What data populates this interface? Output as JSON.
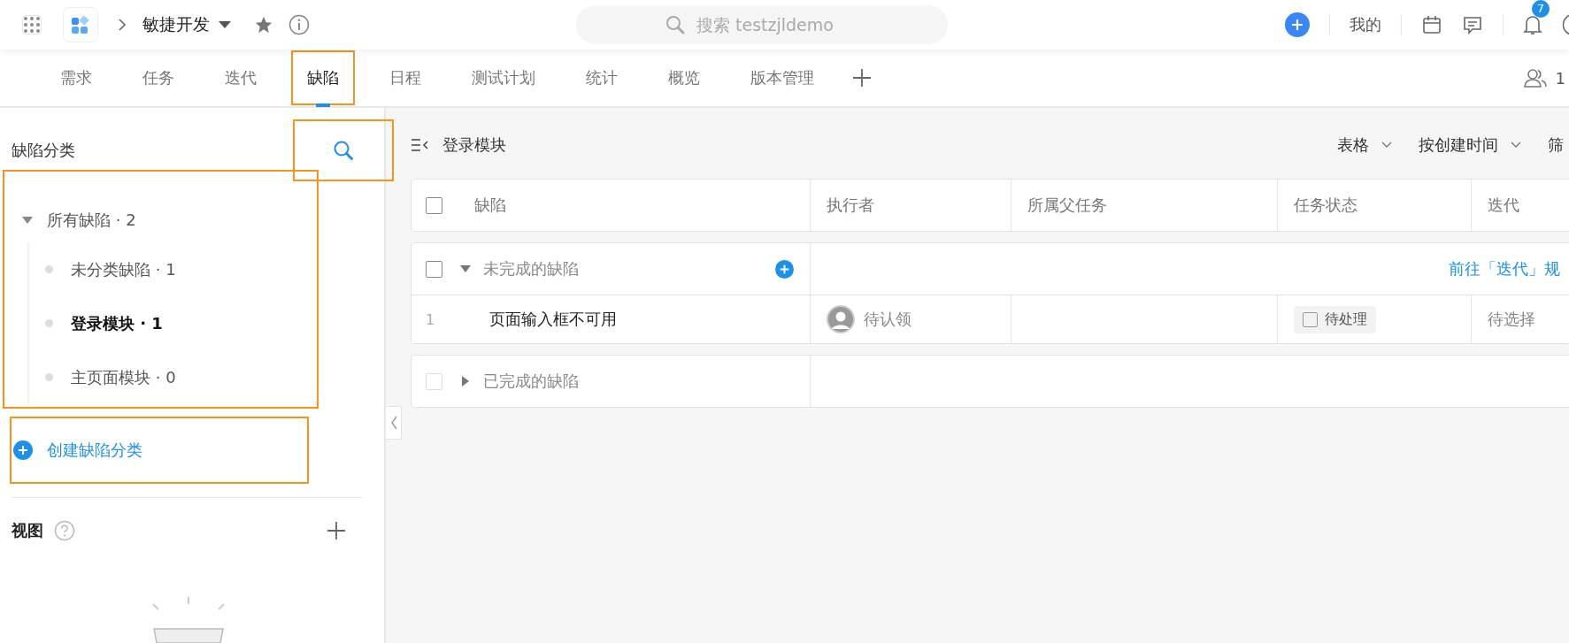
{
  "topbar": {
    "project": "敏捷开发",
    "search": {
      "placeholder": "搜索 testzjldemo"
    },
    "mine": "我的",
    "notifications": "7"
  },
  "tabs": [
    {
      "label": "需求",
      "selected": false,
      "highlighted": false
    },
    {
      "label": "任务",
      "selected": false,
      "highlighted": false
    },
    {
      "label": "迭代",
      "selected": false,
      "highlighted": false
    },
    {
      "label": "缺陷",
      "selected": true,
      "highlighted": true
    },
    {
      "label": "日程",
      "selected": false,
      "highlighted": false
    },
    {
      "label": "测试计划",
      "selected": false,
      "highlighted": false
    },
    {
      "label": "统计",
      "selected": false,
      "highlighted": false
    },
    {
      "label": "概览",
      "selected": false,
      "highlighted": false
    },
    {
      "label": "版本管理",
      "selected": false,
      "highlighted": false
    }
  ],
  "members": "1",
  "sidebar": {
    "title": "缺陷分类",
    "search_highlighted": true,
    "tree_highlighted": true,
    "tree": [
      {
        "label": "所有缺陷 · 2",
        "expanded": true,
        "selected": false,
        "children": [
          {
            "label": "未分类缺陷 · 1",
            "selected": false
          },
          {
            "label": "登录模块 · 1",
            "selected": true
          },
          {
            "label": "主页面模块 · 0",
            "selected": false
          }
        ]
      }
    ],
    "create": {
      "label": "创建缺陷分类",
      "highlighted": true
    },
    "views_title": "视图"
  },
  "main": {
    "breadcrumb": "登录模块",
    "view": "表格",
    "sort": "按创建时间",
    "filter": "筛",
    "header_checked": false,
    "columns": [
      "缺陷",
      "执行者",
      "所属父任务",
      "任务状态",
      "迭代"
    ],
    "groups": [
      {
        "title": "未完成的缺陷",
        "expanded": true,
        "checked": false,
        "disabled": false,
        "link": "前往「迭代」规",
        "rows": [
          {
            "index": "1",
            "title": "页面输入框不可用",
            "assignee": "待认领",
            "status": "待处理",
            "iteration": "待选择"
          }
        ]
      },
      {
        "title": "已完成的缺陷",
        "expanded": false,
        "checked": false,
        "disabled": true
      }
    ]
  }
}
